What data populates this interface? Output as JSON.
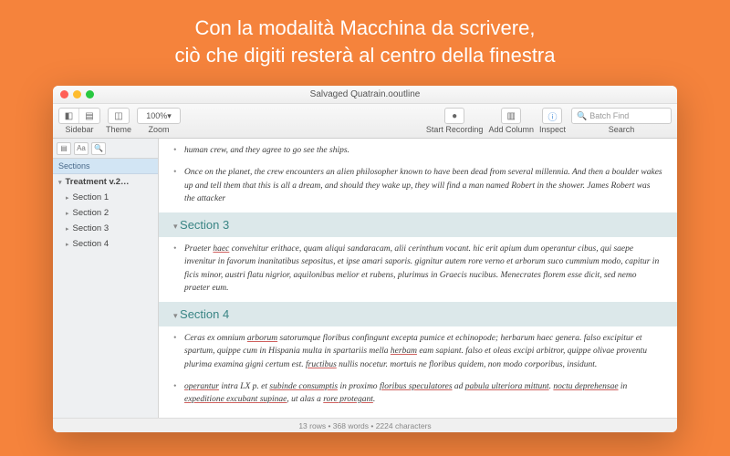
{
  "promo": {
    "line1": "Con la modalità Macchina da scrivere,",
    "line2": "ciò che digiti resterà al centro della finestra"
  },
  "window": {
    "title": "Salvaged Quatrain.ooutline"
  },
  "toolbar": {
    "sidebar_label": "Sidebar",
    "theme_label": "Theme",
    "zoom_label": "Zoom",
    "zoom_value": "100%",
    "record_label": "Start Recording",
    "addcol_label": "Add Column",
    "inspect_label": "Inspect",
    "search_placeholder": "Batch Find",
    "search_label": "Search"
  },
  "sidebar": {
    "head": "Sections",
    "items": [
      {
        "label": "Treatment v.2…",
        "root": true
      },
      {
        "label": "Section 1"
      },
      {
        "label": "Section 2"
      },
      {
        "label": "Section 3"
      },
      {
        "label": "Section 4"
      }
    ]
  },
  "content": {
    "p0": "human crew, and they agree to go see the ships.",
    "p1": "Once on the planet, the crew encounters an alien philosopher known to have been dead from several millennia. And then a boulder wakes up and tell them that this is all a dream, and should they wake up, they will find a man named Robert in the shower. James Robert was the attacker",
    "s3": "Section 3",
    "p2": "Praeter haec convehitur erithace, quam aliqui sandaracam, alii cerinthum vocant. hic erit apium dum operantur cibus, qui saepe invenitur in favorum inanitatibus sepositus, et ipse amari saporis. gignitur autem rore verno et arborum suco cummium modo, capitur in ficis minor, austri flatu nigrior, aquilonibus melior et rubens, plurimus in Graecis nucibus. Menecrates florem esse dicit, sed nemo praeter eum.",
    "s4": "Section 4",
    "p3a": "Ceras ex omnium ",
    "p3u1": "arborum",
    "p3b": " satorumque floribus confingunt excepta pumice et echinopode; herbarum haec genera. falso excipitur et spartum, quippe cum in Hispania multa in spartariis mella ",
    "p3u2": "herbam",
    "p3c": " eam sapiant. falso et oleas excipi arbitror, quippe olivae proventu plurima examina gigni certum est. ",
    "p3u3": "fructibus",
    "p3d": " nullis nocetur. mortuis ne floribus quidem, non modo corporibus, insidunt.",
    "p4a": "operantur",
    "p4b": " intra LX p. et ",
    "p4u1": "subinde consumptis",
    "p4c": " in proximo ",
    "p4u2": "floribus speculatores",
    "p4d": " ad ",
    "p4u3": "pabula ulteriora mittunt",
    "p4e": ". ",
    "p4u4": "noctu deprehensae",
    "p4f": " in ",
    "p4u5": "expeditione excubant supinae",
    "p4g": ", ut alas a ",
    "p4u6": "rore protegant",
    "p4h": "."
  },
  "footer": {
    "text": "13 rows • 368 words • 2224 characters"
  }
}
